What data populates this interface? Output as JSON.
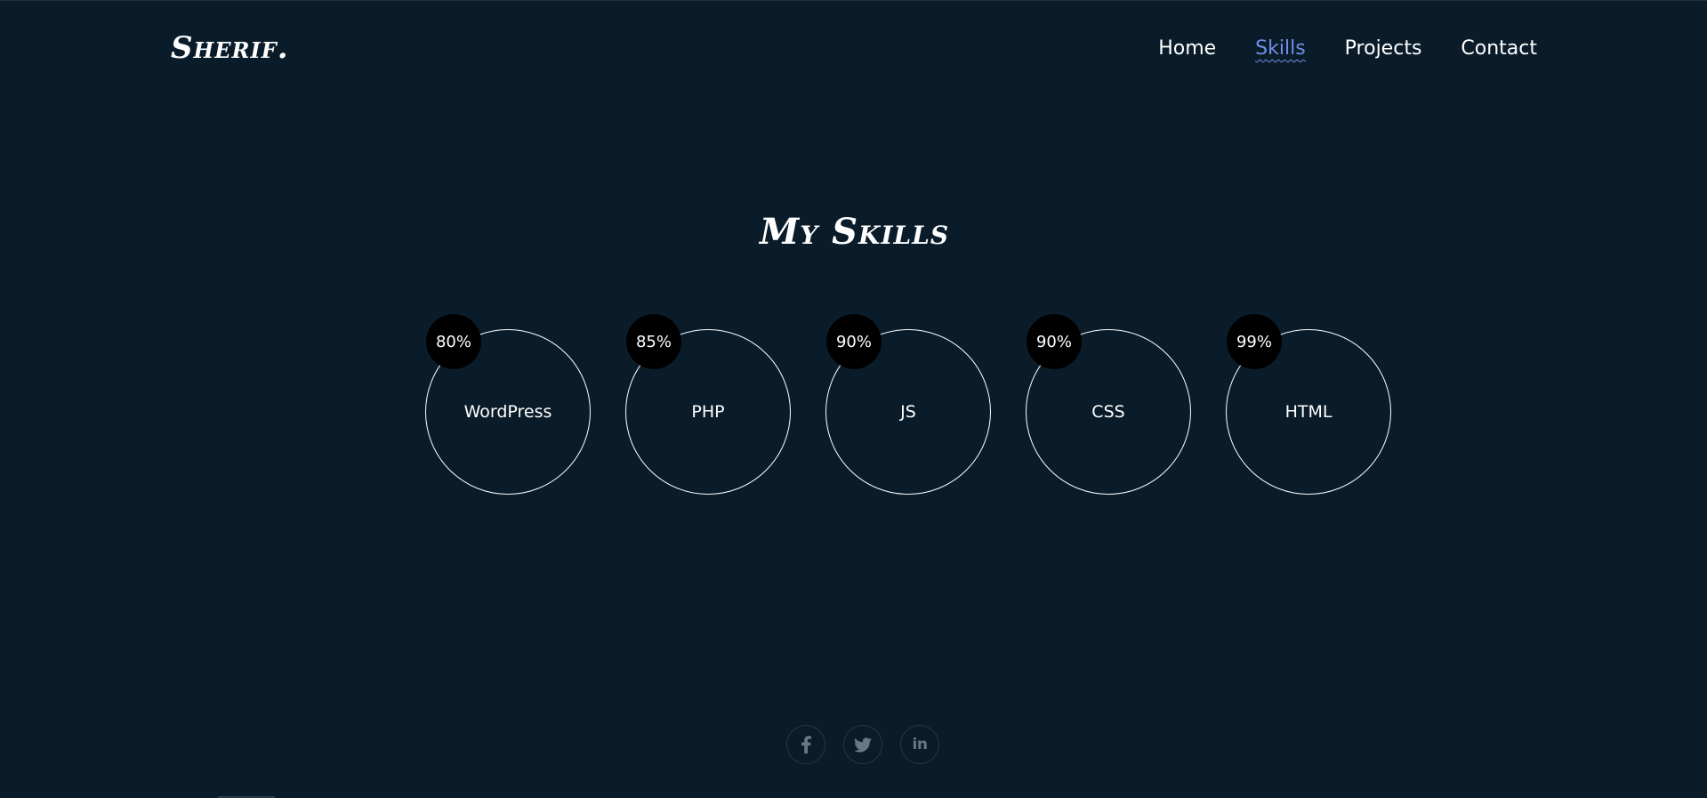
{
  "header": {
    "logo": "Sherif.",
    "nav": [
      {
        "label": "Home",
        "active": false
      },
      {
        "label": "Skills",
        "active": true
      },
      {
        "label": "Projects",
        "active": false
      },
      {
        "label": "Contact",
        "active": false
      }
    ]
  },
  "skills_section": {
    "title": "My Skills",
    "skills": [
      {
        "name": "WordPress",
        "percent": "80%"
      },
      {
        "name": "PHP",
        "percent": "85%"
      },
      {
        "name": "JS",
        "percent": "90%"
      },
      {
        "name": "CSS",
        "percent": "90%"
      },
      {
        "name": "HTML",
        "percent": "99%"
      }
    ]
  },
  "social": [
    {
      "icon": "facebook-icon"
    },
    {
      "icon": "twitter-icon"
    },
    {
      "icon": "linkedin-icon",
      "label": "in"
    }
  ],
  "colors": {
    "background": "#0a1c29",
    "accent": "#6f8fe8",
    "badge": "#000000",
    "social_icon": "#6a7784"
  }
}
